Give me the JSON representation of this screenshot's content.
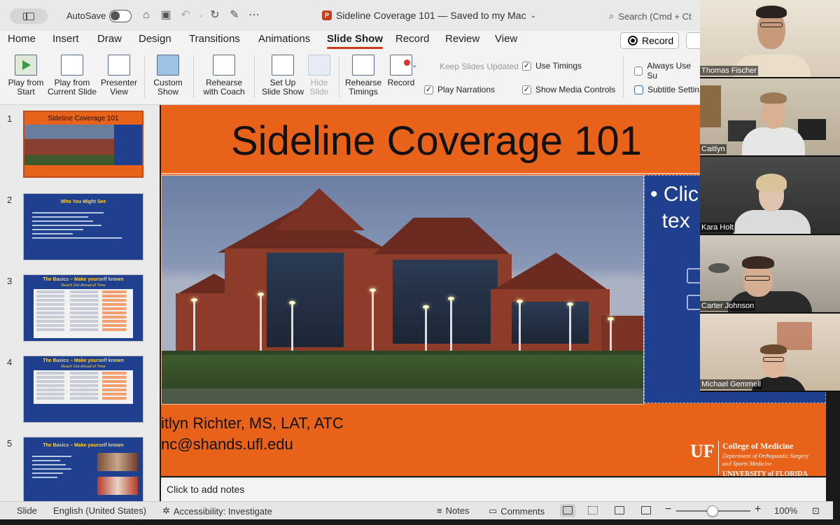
{
  "titlebar": {
    "autosave_label": "AutoSave",
    "doc_title": "Sideline Coverage 101 — Saved to my Mac",
    "search_placeholder": "Search (Cmd + Ct"
  },
  "tabs": [
    "Home",
    "Insert",
    "Draw",
    "Design",
    "Transitions",
    "Animations",
    "Slide Show",
    "Record",
    "Review",
    "View"
  ],
  "active_tab": "Slide Show",
  "record_button": "Record",
  "ribbon": {
    "play_from_start": "Play from\nStart",
    "play_from_current": "Play from\nCurrent Slide",
    "presenter_view": "Presenter\nView",
    "custom_show": "Custom\nShow",
    "rehearse_coach": "Rehearse\nwith Coach",
    "set_up": "Set Up\nSlide Show",
    "hide_slide": "Hide\nSlide",
    "rehearse_timings": "Rehearse\nTimings",
    "record": "Record",
    "keep_slides_updated": "Keep Slides Updated",
    "use_timings": "Use Timings",
    "play_narrations": "Play Narrations",
    "show_media_controls": "Show Media Controls",
    "always_use": "Always Use Su",
    "subtitle_settings": "Subtitle Settin"
  },
  "thumbnails": [
    {
      "num": "1",
      "title": "Sideline Coverage 101"
    },
    {
      "num": "2",
      "title": "Who You Might See"
    },
    {
      "num": "3",
      "title": "The Basics – Make yourself known",
      "subtitle": "Reach Out Ahead of Time"
    },
    {
      "num": "4",
      "title": "The Basics – Make yourself known",
      "subtitle": "Reach Out Ahead of Time"
    },
    {
      "num": "5",
      "title": "The Basics – Make yourself known"
    }
  ],
  "slide": {
    "title": "Sideline Coverage 101",
    "placeholder_text": "• Clic\n  tex",
    "presenter_name": "itlyn Richter, MS, LAT, ATC",
    "presenter_email": "nc@shands.ufl.edu",
    "logo": {
      "mark": "UF",
      "line1": "College of Medicine",
      "line2": "Department of Orthopaedic Surgery\nand Sports Medicine",
      "line3": "UNIVERSITY of FLORIDA"
    }
  },
  "notes_placeholder": "Click to add notes",
  "statusbar": {
    "slide": "Slide",
    "language": "English (United States)",
    "accessibility": "Accessibility: Investigate",
    "notes": "Notes",
    "comments": "Comments",
    "zoom": "100%"
  },
  "participants": [
    "Thomas Fischer",
    "Caitlyn",
    "Kara Holt",
    "Carter Johnson",
    "Michael Gemmell"
  ],
  "colors": {
    "slide_orange": "#e8621a",
    "slide_blue": "#1f3f8f",
    "ppt_accent": "#c43e1c"
  }
}
